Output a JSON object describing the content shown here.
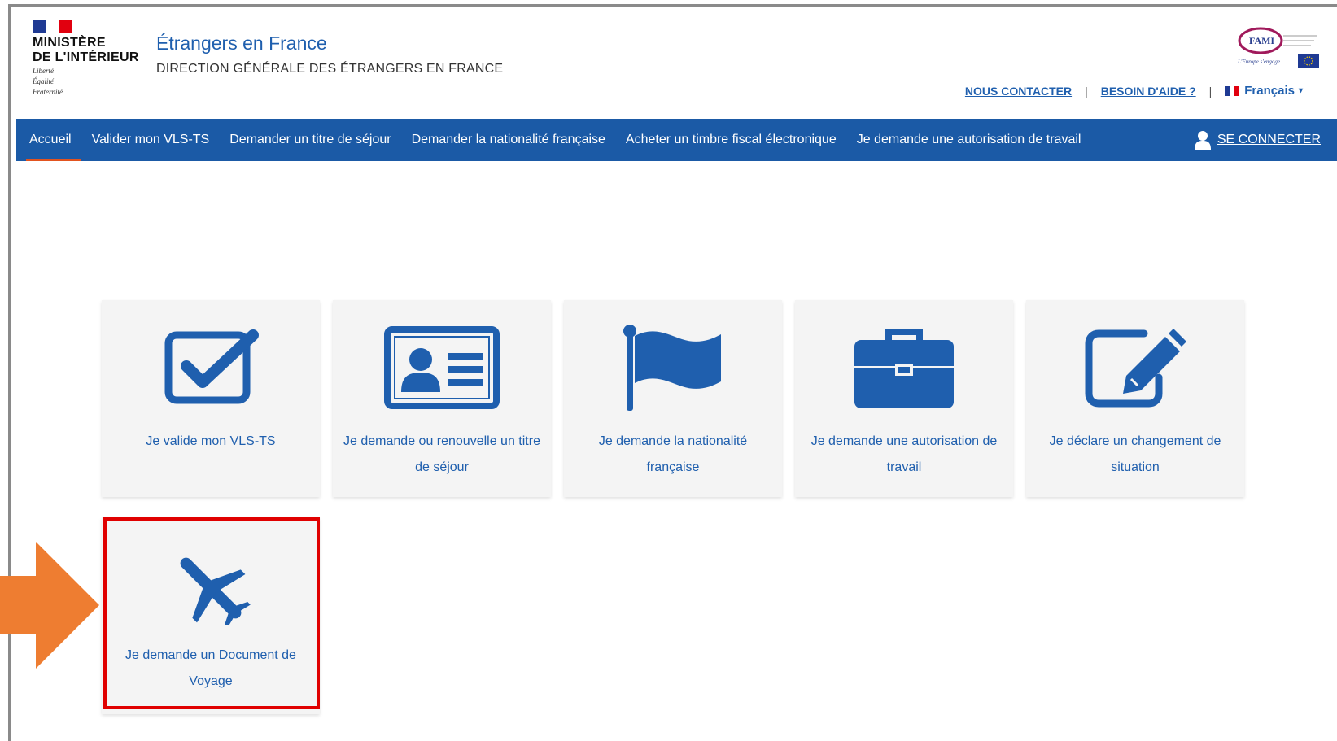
{
  "header": {
    "ministry_line1": "MINISTÈRE",
    "ministry_line2": "DE L'INTÉRIEUR",
    "motto_1": "Liberté",
    "motto_2": "Égalité",
    "motto_3": "Fraternité",
    "site_title": "Étrangers en France",
    "site_subtitle": "DIRECTION GÉNÉRALE DES ÉTRANGERS EN FRANCE",
    "contact_link": "NOUS CONTACTER",
    "help_link": "BESOIN D'AIDE ?",
    "separator": "|",
    "language": "Français",
    "fami_logo_text": "FAMI",
    "fami_tagline": "L'Europe s'engage"
  },
  "nav": {
    "items": [
      {
        "label": "Accueil",
        "active": true
      },
      {
        "label": "Valider mon VLS-TS"
      },
      {
        "label": "Demander un titre de séjour"
      },
      {
        "label": "Demander la nationalité française"
      },
      {
        "label": "Acheter un timbre fiscal électronique"
      },
      {
        "label": "Je demande une autorisation de travail"
      }
    ],
    "login": "SE CONNECTER"
  },
  "cards": [
    {
      "label": "Je valide mon VLS-TS",
      "icon": "checkbox-icon"
    },
    {
      "label": "Je demande ou renouvelle un titre de séjour",
      "icon": "id-card-icon"
    },
    {
      "label": "Je demande la nationalité française",
      "icon": "flag-icon"
    },
    {
      "label": "Je demande une autorisation de travail",
      "icon": "briefcase-icon"
    },
    {
      "label": "Je déclare un changement de situation",
      "icon": "edit-icon"
    },
    {
      "label": "Je demande un Document de Voyage",
      "icon": "airplane-icon"
    }
  ],
  "colors": {
    "brand_blue": "#1b5aa6",
    "link_blue": "#1f5fae",
    "active_underline": "#e2531f",
    "highlight_red": "#e00000",
    "arrow_orange": "#ee7d31",
    "card_bg": "#f4f4f4"
  }
}
